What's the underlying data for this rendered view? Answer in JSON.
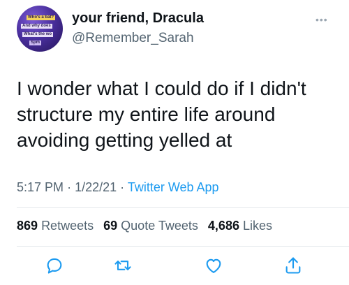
{
  "avatar": {
    "caption_lines": [
      "Who's a bat?",
      "And why does",
      "What's the wo",
      "Spm"
    ]
  },
  "tweet": {
    "display_name": "your friend, Dracula",
    "handle": "@Remember_Sarah",
    "text_lines": [
      "I wonder what I could do if I didn't",
      "structure my entire life around",
      "avoiding getting yelled at"
    ],
    "time": "5:17 PM",
    "date": "1/22/21",
    "separator": "·",
    "source": "Twitter Web App"
  },
  "stats": {
    "retweets_count": "869",
    "retweets_label": "Retweets",
    "quotes_count": "69",
    "quotes_label": "Quote Tweets",
    "likes_count": "4,686",
    "likes_label": "Likes"
  },
  "colors": {
    "text": "#0f1419",
    "secondary": "#536471",
    "link": "#1d9bf0",
    "divider": "#e3e8ec"
  },
  "icons": {
    "reply": "reply-icon",
    "retweet": "retweet-icon",
    "like": "heart-icon",
    "share": "share-icon",
    "more": "more-dots-icon"
  }
}
